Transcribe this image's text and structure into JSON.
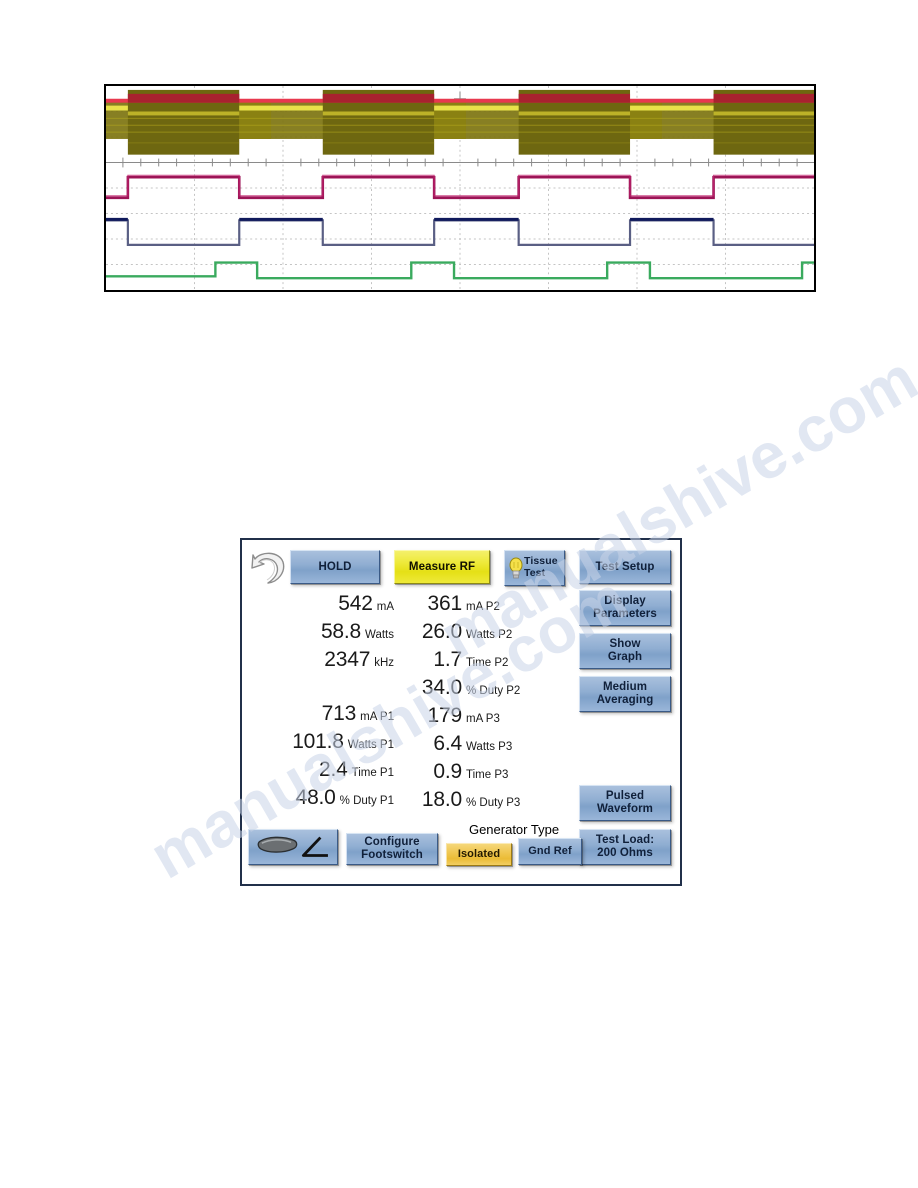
{
  "scope": {
    "name": "oscilloscope-capture",
    "traces": [
      {
        "name": "rf-envelope",
        "color": "#7d7410",
        "accent": "#e8384f",
        "highlight": "#f2ea55"
      },
      {
        "name": "current-trace",
        "color": "#9c1456"
      },
      {
        "name": "voltage-trace",
        "color": "#2b2e7a"
      },
      {
        "name": "footswitch-trace",
        "color": "#3aaa5e"
      }
    ],
    "grid_color": "#bfbfbf",
    "border_color": "#000000",
    "background": "#ffffff"
  },
  "panel": {
    "background": "#ffffff",
    "border_color": "#21304a",
    "accent_blue": "#90aed2",
    "accent_yellow": "#e5e016",
    "accent_gold": "#ebbc36",
    "top_buttons": {
      "refresh_icon": "refresh-arrow-icon",
      "hold": "HOLD",
      "measure_rf": "Measure RF",
      "tissue_test_line1": "Tissue",
      "tissue_test_line2": "Test",
      "tissue_test_icon": "lightbulb-icon",
      "test_setup": "Test Setup"
    },
    "side_buttons": {
      "display_line1": "Display",
      "display_line2": "Parameters",
      "show_line1": "Show",
      "show_line2": "Graph",
      "averaging_line1": "Medium",
      "averaging_line2": "Averaging",
      "waveform_line1": "Pulsed",
      "waveform_line2": "Waveform",
      "testload_line1": "Test Load:",
      "testload_line2": "200 Ohms"
    },
    "bottom": {
      "footswitch_icon": "foot-pedal-icon",
      "configure_line1": "Configure",
      "configure_line2": "Footswitch",
      "generator_type_label": "Generator Type",
      "isolated": "Isolated",
      "gnd_ref": "Gnd Ref"
    },
    "readouts": {
      "left": [
        {
          "value": "542",
          "unit": "mA"
        },
        {
          "value": "58.8",
          "unit": "Watts"
        },
        {
          "value": "2347",
          "unit": "kHz"
        },
        {
          "value": "713",
          "unit": "mA P1"
        },
        {
          "value": "101.8",
          "unit": "Watts P1"
        },
        {
          "value": "2.4",
          "unit": "Time P1"
        },
        {
          "value": "48.0",
          "unit": "% Duty P1"
        }
      ],
      "right": [
        {
          "value": "361",
          "unit": "mA P2"
        },
        {
          "value": "26.0",
          "unit": "Watts P2"
        },
        {
          "value": "1.7",
          "unit": "Time P2"
        },
        {
          "value": "34.0",
          "unit": "% Duty P2"
        },
        {
          "value": "179",
          "unit": "mA P3"
        },
        {
          "value": "6.4",
          "unit": "Watts P3"
        },
        {
          "value": "0.9",
          "unit": "Time P3"
        },
        {
          "value": "18.0",
          "unit": "% Duty P3"
        }
      ]
    }
  },
  "watermark": {
    "line_a": "manualshive.com",
    "line_b": "manualshive.com"
  }
}
